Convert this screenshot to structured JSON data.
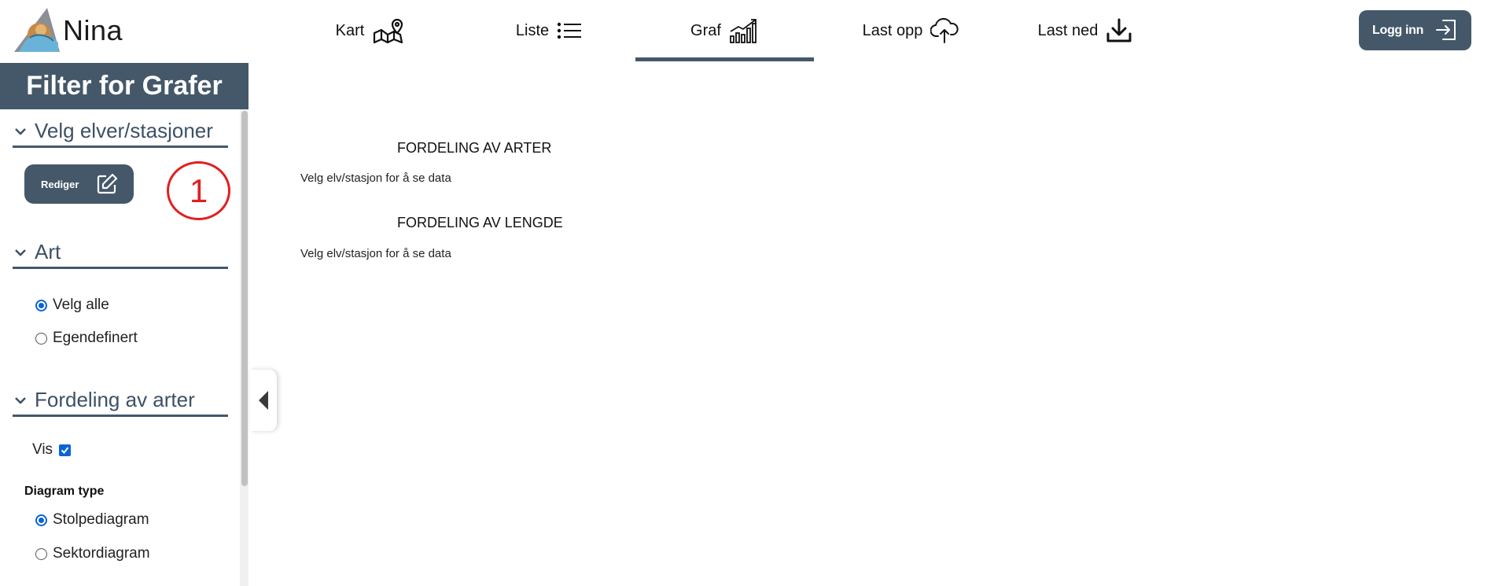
{
  "app": {
    "name": "Nina"
  },
  "nav": {
    "items": [
      {
        "label": "Kart",
        "icon": "map-pin-icon"
      },
      {
        "label": "Liste",
        "icon": "list-icon"
      },
      {
        "label": "Graf",
        "icon": "bar-chart-icon",
        "active": true
      },
      {
        "label": "Last opp",
        "icon": "cloud-upload-icon"
      },
      {
        "label": "Last ned",
        "icon": "download-icon"
      }
    ],
    "login_label": "Logg inn"
  },
  "sidebar": {
    "title": "Filter for Grafer",
    "sections": {
      "rivers": {
        "title": "Velg elver/stasjoner",
        "edit_label": "Rediger"
      },
      "species": {
        "title": "Art",
        "options": [
          {
            "label": "Velg alle",
            "selected": true
          },
          {
            "label": "Egendefinert",
            "selected": false
          }
        ]
      },
      "distribution": {
        "title": "Fordeling av arter",
        "show_label": "Vis",
        "show_checked": true,
        "diagram_type_label": "Diagram type",
        "options": [
          {
            "label": "Stolpediagram",
            "selected": true
          },
          {
            "label": "Sektordiagram",
            "selected": false
          }
        ]
      }
    }
  },
  "annotation": {
    "number": "1"
  },
  "main": {
    "charts": [
      {
        "heading": "FORDELING AV ARTER",
        "message": "Velg elv/stasjon for å se data"
      },
      {
        "heading": "FORDELING AV LENGDE",
        "message": "Velg elv/stasjon for å se data"
      }
    ]
  },
  "colors": {
    "primary": "#44586a",
    "accent_red": "#e02020",
    "checkbox_blue": "#0b63d6"
  }
}
